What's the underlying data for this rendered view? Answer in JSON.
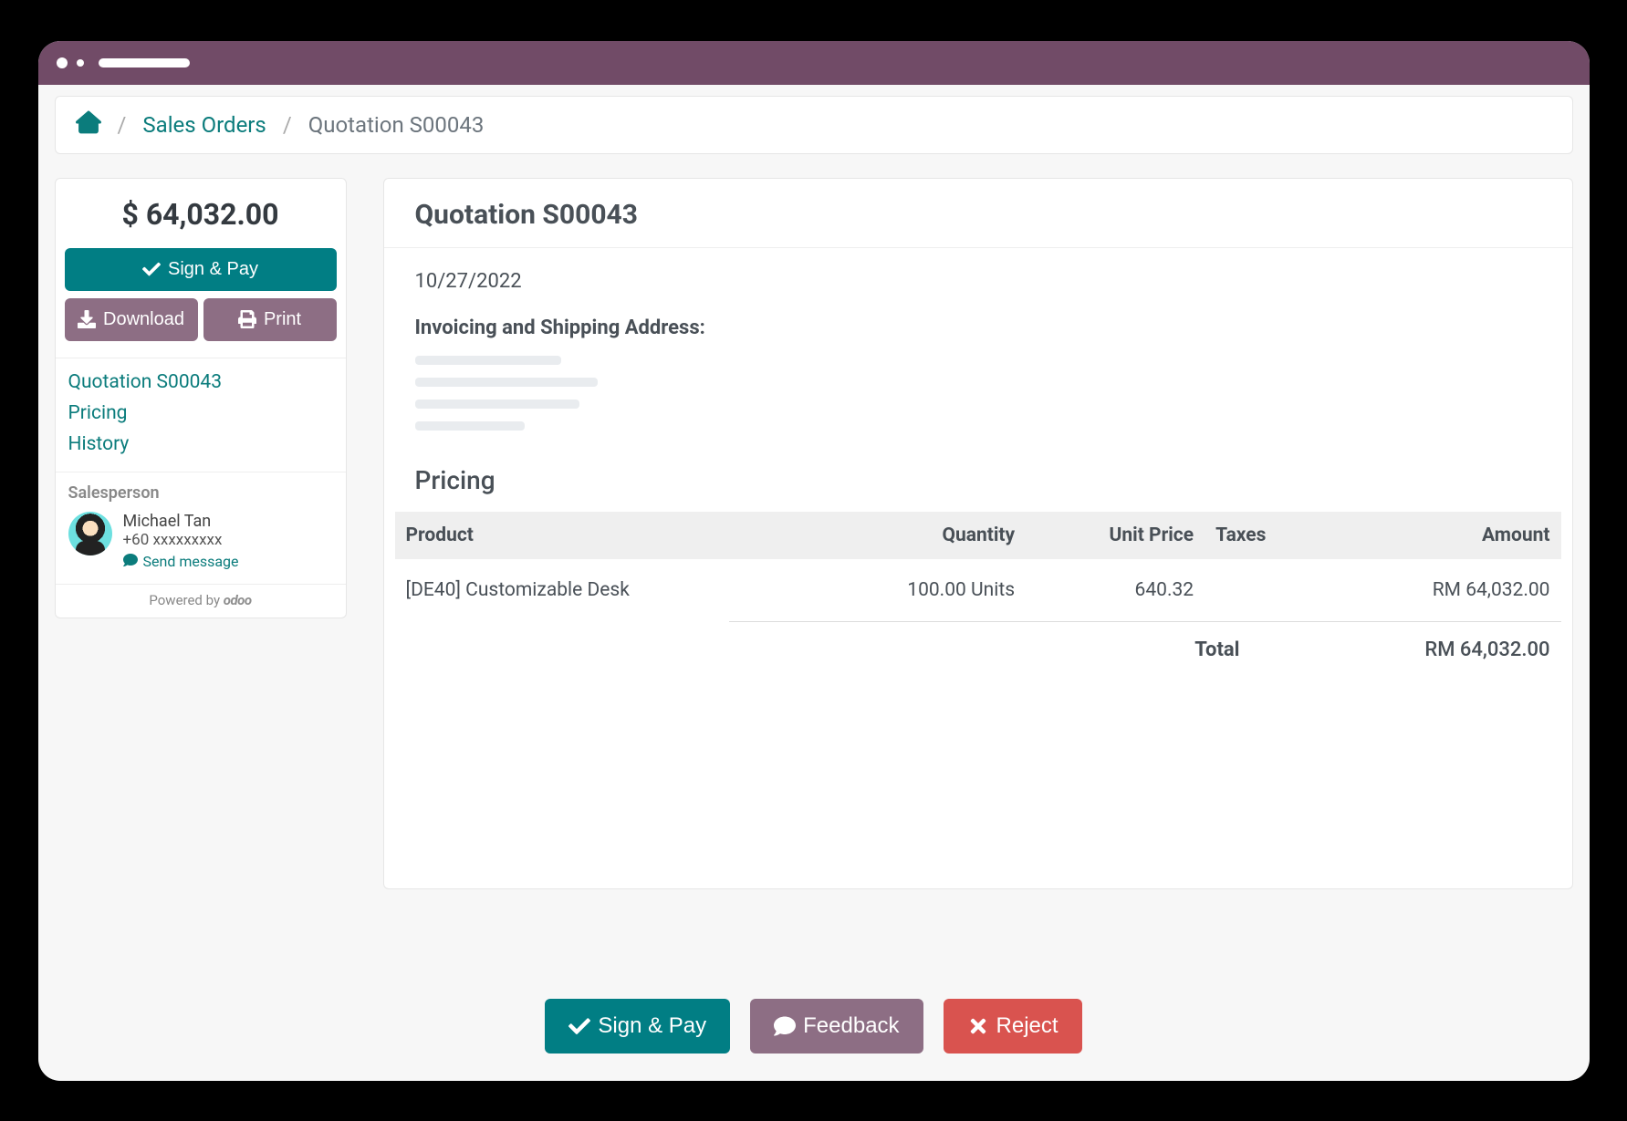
{
  "breadcrumb": {
    "home_label": "Home",
    "sales_orders_label": "Sales Orders",
    "current": "Quotation S00043"
  },
  "sidebar": {
    "amount": "$ 64,032.00",
    "sign_pay_label": "Sign & Pay",
    "download_label": "Download",
    "print_label": "Print",
    "links": {
      "quotation": "Quotation S00043",
      "pricing": "Pricing",
      "history": "History"
    },
    "salesperson_label": "Salesperson",
    "salesperson": {
      "name": "Michael Tan",
      "phone": "+60 xxxxxxxxx",
      "send_message_label": "Send message"
    },
    "powered_by_label": "Powered by",
    "powered_by_brand": "odoo"
  },
  "main": {
    "title": "Quotation S00043",
    "date": "10/27/2022",
    "address_label": "Invoicing and Shipping Address:",
    "pricing_heading": "Pricing",
    "columns": {
      "product": "Product",
      "quantity": "Quantity",
      "unit_price": "Unit Price",
      "taxes": "Taxes",
      "amount": "Amount"
    },
    "lines": [
      {
        "product": "[DE40] Customizable Desk",
        "quantity": "100.00 Units",
        "unit_price": "640.32",
        "taxes": "",
        "amount": "RM 64,032.00"
      }
    ],
    "total_label": "Total",
    "total_value": "RM 64,032.00"
  },
  "footer": {
    "sign_pay_label": "Sign & Pay",
    "feedback_label": "Feedback",
    "reject_label": "Reject"
  }
}
